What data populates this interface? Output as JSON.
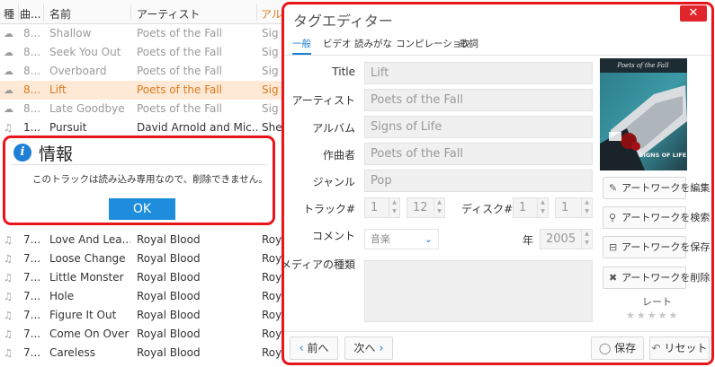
{
  "tracklist": {
    "headers": {
      "type": "種",
      "number": "曲...",
      "name": "名前",
      "artist": "アーティスト",
      "album": "アルバ"
    },
    "rows": [
      {
        "icon": "cloud-icon",
        "num": "8...",
        "name": "Shallow",
        "artist": "Poets of the Fall",
        "album": "Sig",
        "state": "dim"
      },
      {
        "icon": "cloud-icon",
        "num": "8...",
        "name": "Seek You Out",
        "artist": "Poets of the Fall",
        "album": "Sig",
        "state": "dim"
      },
      {
        "icon": "cloud-icon",
        "num": "8...",
        "name": "Overboard",
        "artist": "Poets of the Fall",
        "album": "Sig",
        "state": "dim"
      },
      {
        "icon": "cloud-icon",
        "num": "8...",
        "name": "Lift",
        "artist": "Poets of the Fall",
        "album": "Sig",
        "state": "selected"
      },
      {
        "icon": "cloud-icon",
        "num": "8...",
        "name": "Late Goodbye",
        "artist": "Poets of the Fall",
        "album": "Sig",
        "state": "dim"
      },
      {
        "icon": "music-note-icon",
        "num": "1...",
        "name": "Pursuit",
        "artist": "David Arnold and Mic...",
        "album": "She",
        "state": "normal"
      },
      {
        "icon": "music-note-icon",
        "num": "7...",
        "name": "Love And Lea...",
        "artist": "Royal Blood",
        "album": "Roy",
        "state": "normal"
      },
      {
        "icon": "music-note-icon",
        "num": "7...",
        "name": "Loose Change",
        "artist": "Royal Blood",
        "album": "Roy",
        "state": "normal"
      },
      {
        "icon": "music-note-icon",
        "num": "7...",
        "name": "Little Monster",
        "artist": "Royal Blood",
        "album": "Roy",
        "state": "normal"
      },
      {
        "icon": "music-note-icon",
        "num": "7...",
        "name": "Hole",
        "artist": "Royal Blood",
        "album": "Roy",
        "state": "normal"
      },
      {
        "icon": "music-note-icon",
        "num": "7...",
        "name": "Figure It Out",
        "artist": "Royal Blood",
        "album": "Roy",
        "state": "normal"
      },
      {
        "icon": "music-note-icon",
        "num": "7...",
        "name": "Come On Over",
        "artist": "Royal Blood",
        "album": "Roy",
        "state": "normal"
      },
      {
        "icon": "music-note-icon",
        "num": "7...",
        "name": "Careless",
        "artist": "Royal Blood",
        "album": "Roy",
        "state": "normal"
      }
    ]
  },
  "info_dialog": {
    "title": "情報",
    "message": "このトラックは読み込み専用なので、削除できません。",
    "ok_label": "OK"
  },
  "editor": {
    "title": "タグエディター",
    "close_glyph": "✕",
    "tabs": [
      "一般",
      "ビデオ",
      "読みがな",
      "コンピレーション",
      "歌詞"
    ],
    "active_tab": "一般",
    "labels": {
      "title": "Title",
      "artist": "アーティスト",
      "album": "アルバム",
      "composer": "作曲者",
      "genre": "ジャンル",
      "track": "トラック#",
      "disc": "ディスク#",
      "comment": "コメント",
      "year": "年",
      "media_type": "メディアの種類"
    },
    "values": {
      "title": "Lift",
      "artist": "Poets of the Fall",
      "album": "Signs of Life",
      "composer": "Poets of the Fall",
      "genre": "Pop",
      "track_number": "1",
      "track_total": "12",
      "disc_number": "1",
      "disc_total": "1",
      "comment_type": "音楽",
      "year": "2005"
    },
    "artwork": {
      "band_text": "Poets of the Fall",
      "album_text": "SIGNS OF LIFE"
    },
    "artwork_buttons": {
      "edit": "アートワークを編集",
      "search": "アートワークを検索",
      "save": "アートワークを保存",
      "delete": "アートワークを削除"
    },
    "rating_label": "レート",
    "rating_stars": "★★★★★",
    "footer": {
      "prev": "前へ",
      "next": "次へ",
      "save": "保存",
      "reset": "リセット"
    },
    "colors": {
      "accent": "#1e7fd6",
      "highlight": "#e8151b"
    }
  }
}
